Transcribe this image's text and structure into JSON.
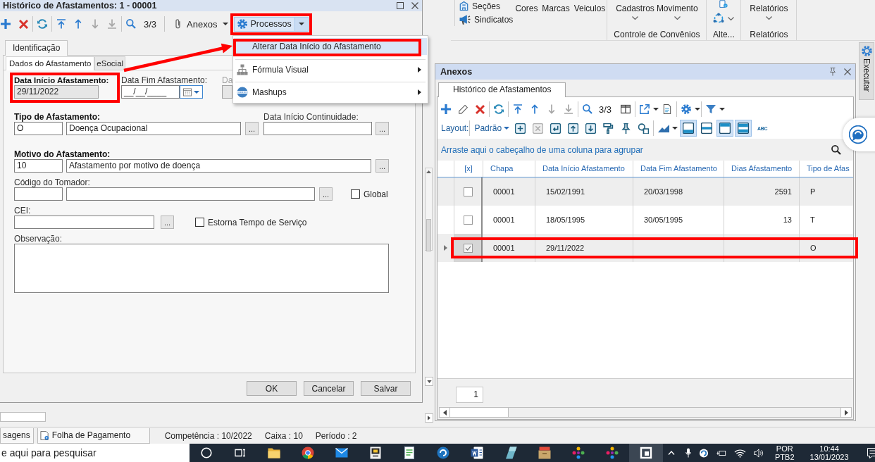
{
  "ribbon": {
    "column_items": [
      {
        "label": "Seções"
      },
      {
        "label": "Sindicatos"
      }
    ],
    "buttons": [
      {
        "label": "Cores"
      },
      {
        "label": "Marcas"
      },
      {
        "label": "Veiculos"
      }
    ],
    "groups": [
      {
        "kind": "text",
        "buttons": [
          {
            "label": "Cadastros"
          },
          {
            "label": "Movimento"
          }
        ],
        "caption": "Controle de Convênios"
      },
      {
        "kind": "icons",
        "caption": "Alte..."
      },
      {
        "kind": "text",
        "buttons": [
          {
            "label": "Relatórios"
          }
        ],
        "caption": "Relatórios"
      }
    ]
  },
  "dialog": {
    "title": "Histórico de Afastamentos: 1 - 00001",
    "toolbar": {
      "navigation": [
        {
          "disabled": false
        },
        {
          "disabled": false
        },
        {
          "disabled": true
        },
        {
          "disabled": true
        }
      ],
      "counter": "3/3",
      "attachments": "Anexos",
      "processes": {
        "label": "Processos",
        "open": true,
        "annotated": true
      }
    },
    "tabs": [
      {
        "label": "Identificação",
        "selected": true
      }
    ],
    "subtabs": [
      {
        "label": "Dados do Afastamento",
        "selected": true
      },
      {
        "label": "eSocial",
        "selected": false
      }
    ],
    "form": {
      "start_date": {
        "label": "Data Início Afastamento:",
        "value": "29/11/2022",
        "disabled": true,
        "annotated": true
      },
      "end_date": {
        "label": "Data Fim Afastamento:",
        "value": "__/__/____"
      },
      "field_3": {
        "label": "Da",
        "disabled": true
      },
      "leave_type": {
        "label": "Tipo de Afastamento:",
        "code": "O",
        "description": "Doença Ocupacional",
        "lookup": "..."
      },
      "continuity_date": {
        "label": "Data Início Continuidade:",
        "lookup": "..."
      },
      "reason": {
        "label": "Motivo do Afastamento:",
        "code": "10",
        "description": "Afastamento por motivo de doença",
        "lookup": "..."
      },
      "contractor": {
        "label": "Código do Tomador:",
        "lookup": "..."
      },
      "global": {
        "label": "Global",
        "checked": false
      },
      "cei": {
        "label": "CEI:",
        "lookup": "..."
      },
      "reverse_service": {
        "label": "Estorna Tempo de Serviço",
        "checked": false
      },
      "notes": {
        "label": "Observação:"
      }
    },
    "buttons": [
      {
        "label": "OK"
      },
      {
        "label": "Cancelar"
      },
      {
        "label": "Salvar"
      }
    ]
  },
  "processes_menu": {
    "items": [
      {
        "label": "Alterar Data Início do Afastamento",
        "selected": true,
        "submenu": false,
        "annotated": true
      },
      {
        "label": "Fórmula Visual",
        "selected": false,
        "submenu": true,
        "annotated": false
      },
      {
        "label": "Mashups",
        "selected": false,
        "submenu": true,
        "annotated": false
      }
    ]
  },
  "annotation_arrow": true,
  "anexos": {
    "title": "Anexos",
    "tabs": [
      {
        "label": "Histórico de Afastamentos",
        "selected": true
      }
    ],
    "toolbar": {
      "navigation": [
        {
          "disabled": false
        },
        {
          "disabled": false
        },
        {
          "disabled": true
        },
        {
          "disabled": true
        }
      ],
      "counter": "3/3"
    },
    "layout": {
      "label": "Layout:",
      "value": "Padrão",
      "tools": [
        {
          "disabled": false
        },
        {
          "disabled": true
        },
        {
          "disabled": false
        },
        {
          "disabled": false
        },
        {
          "disabled": false
        },
        {
          "disabled": false
        },
        {
          "disabled": false
        },
        {
          "disabled": false
        }
      ],
      "views": [
        {
          "selected": true
        },
        {
          "selected": false
        },
        {
          "selected": true
        },
        {
          "selected": true
        }
      ],
      "text_tool": "ABC"
    },
    "group_hint": "Arraste aqui o cabeçalho de uma coluna para agrupar",
    "grid": {
      "check_column": "[x]",
      "columns": [
        "Chapa",
        "Data Início Afastamento",
        "Data Fim Afastamento",
        "Dias Afastamento",
        "Tipo de Afas"
      ],
      "rows": [
        {
          "selected": false,
          "checked": false,
          "annotated": false,
          "cells": [
            "00001",
            "15/02/1991",
            "20/03/1998",
            "2591",
            "P"
          ]
        },
        {
          "selected": false,
          "checked": false,
          "annotated": false,
          "cells": [
            "00001",
            "18/05/1995",
            "30/05/1995",
            "13",
            "T"
          ]
        },
        {
          "selected": true,
          "checked": true,
          "annotated": true,
          "cells": [
            "00001",
            "29/11/2022",
            null,
            null,
            "O"
          ]
        }
      ]
    },
    "page": "1"
  },
  "side_tab": {
    "label": "Executar"
  },
  "status_bar": {
    "tabs": [
      {
        "label": "sagens"
      },
      {
        "label": "Folha de Pagamento"
      }
    ],
    "fields": [
      "Competência : 10/2022",
      "Caixa : 10",
      "Período : 2"
    ]
  },
  "taskbar": {
    "search": {
      "placeholder": "e aqui para pesquisar"
    },
    "apps": [
      {
        "selected": false
      },
      {
        "selected": false
      },
      {
        "selected": false
      },
      {
        "selected": false
      },
      {
        "selected": false
      },
      {
        "selected": false
      },
      {
        "selected": false
      },
      {
        "selected": false
      },
      {
        "selected": false
      },
      {
        "selected": false
      },
      {
        "selected": false
      },
      {
        "selected": true
      }
    ],
    "language": [
      "POR",
      "PTB2"
    ],
    "time": "10:44",
    "date": "13/01/2023"
  }
}
